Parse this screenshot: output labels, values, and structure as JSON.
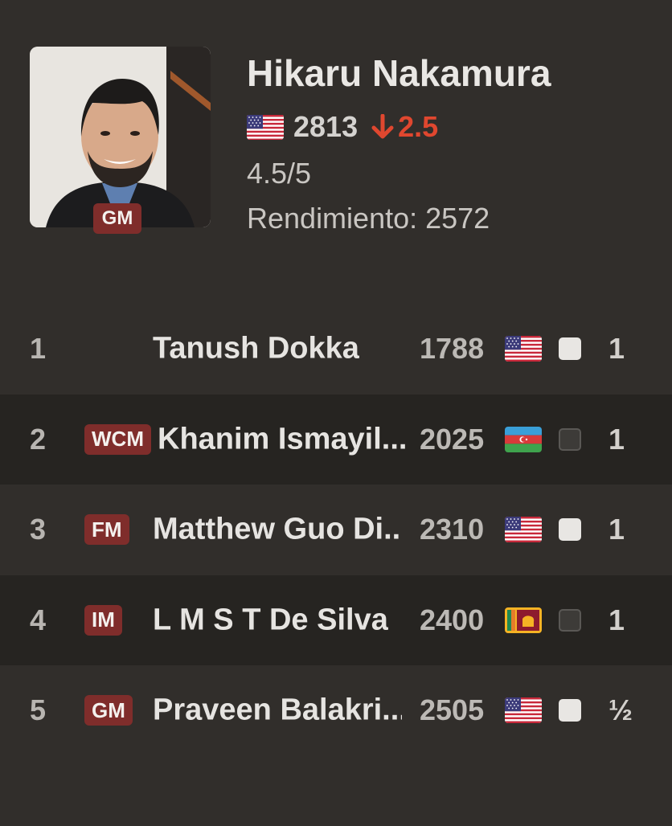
{
  "player": {
    "name": "Hikaru Nakamura",
    "title": "GM",
    "flag": "us-flag-icon",
    "rating": "2813",
    "rating_change": "2.5",
    "rating_change_direction": "down",
    "score": "4.5/5",
    "performance": "Rendimiento: 2572"
  },
  "rounds": [
    {
      "round": "1",
      "title": "",
      "name": "Tanush Dokka",
      "rating": "1788",
      "flag": "us-flag-icon",
      "color": "white",
      "result": "1"
    },
    {
      "round": "2",
      "title": "WCM",
      "name": "Khanim Ismayil...",
      "rating": "2025",
      "flag": "azerbaijan-flag-icon",
      "color": "black",
      "result": "1"
    },
    {
      "round": "3",
      "title": "FM",
      "name": "Matthew Guo Di...",
      "rating": "2310",
      "flag": "us-flag-icon",
      "color": "white",
      "result": "1"
    },
    {
      "round": "4",
      "title": "IM",
      "name": "L M S T De Silva",
      "rating": "2400",
      "flag": "sri-lanka-flag-icon",
      "color": "black",
      "result": "1"
    },
    {
      "round": "5",
      "title": "GM",
      "name": "Praveen Balakri...",
      "rating": "2505",
      "flag": "us-flag-icon",
      "color": "white",
      "result": "½"
    }
  ],
  "colors": {
    "background": "#312e2b",
    "row_alt": "#262421",
    "title_badge": "#7f2d2b",
    "rating_down": "#e0472f"
  }
}
